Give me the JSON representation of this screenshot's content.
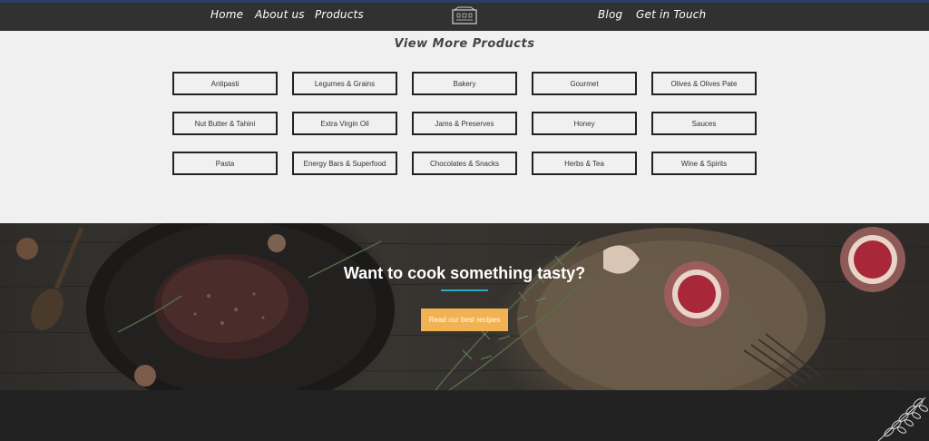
{
  "nav": {
    "left": [
      "Home",
      "About us",
      "Products"
    ],
    "right": [
      "Blog",
      "Get in Touch"
    ]
  },
  "products": {
    "title": "View More Products",
    "categories": [
      "Antipasti",
      "Legumes & Grains",
      "Bakery",
      "Gourmet",
      "Olives & Olives Pate",
      "Nut Butter & Tahini",
      "Extra Virgin Oil",
      "Jams & Preserves",
      "Honey",
      "Sauces",
      "Pasta",
      "Energy Bars & Superfood",
      "Chocolates & Snacks",
      "Herbs & Tea",
      "Wine & Spirits"
    ]
  },
  "hero": {
    "title": "Want to cook something tasty?",
    "button_label": "Read our best recipes",
    "accent_line_color": "#2aa9c9",
    "button_color": "#f0b252"
  },
  "icons": {
    "logo": "shop-logo-icon",
    "footer_decoration": "herb-sprig-icon"
  }
}
